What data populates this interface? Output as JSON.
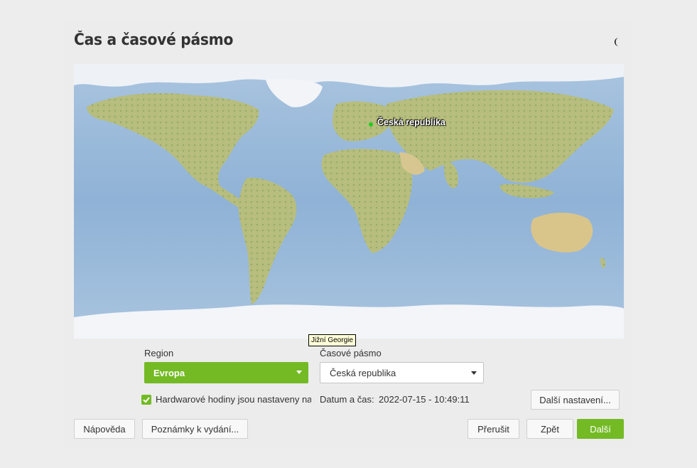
{
  "title": "Čas a časové pásmo",
  "icons": {
    "theme": "moon-icon",
    "check": "checkmark-icon"
  },
  "colors": {
    "accent": "#73ba25",
    "ocean": "#9cbad8",
    "land": "#b9c382",
    "ice": "#f4f6f8",
    "marker": "#22cc22"
  },
  "map": {
    "selected_location": "Česká republika",
    "tooltip": "Jižní Georgie"
  },
  "region": {
    "label": "Region",
    "value": "Evropa"
  },
  "timezone": {
    "label": "Časové pásmo",
    "value": "Česká republika"
  },
  "hwclock": {
    "label": "Hardwarové hodiny jsou nastaveny na",
    "checked": true
  },
  "datetime": {
    "label": "Datum a čas:",
    "value": "2022-07-15 - 10:49:11"
  },
  "buttons": {
    "other_settings": "Další nastavení...",
    "help": "Nápověda",
    "release_notes": "Poznámky k vydání...",
    "abort": "Přerušit",
    "back": "Zpět",
    "next": "Další"
  }
}
